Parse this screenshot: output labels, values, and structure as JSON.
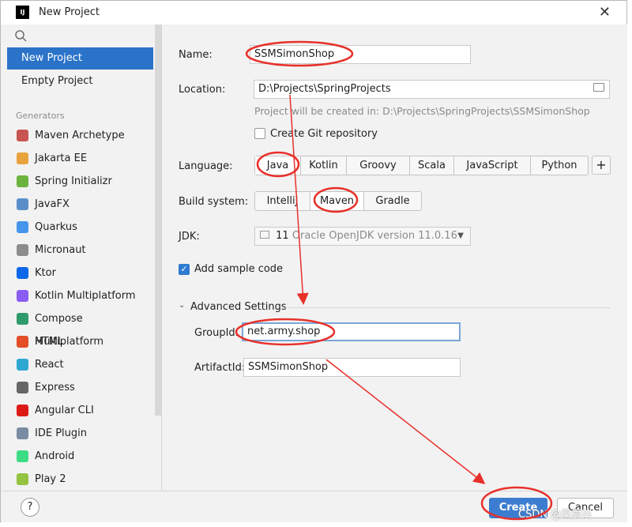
{
  "window": {
    "title": "New Project",
    "logo_text": "IJ"
  },
  "sidebar": {
    "top_items": [
      {
        "label": "New Project",
        "selected": true
      },
      {
        "label": "Empty Project",
        "selected": false
      }
    ],
    "generators_header": "Generators",
    "generators": [
      {
        "label": "Maven Archetype",
        "icon": "maven-icon",
        "color": "#c75450"
      },
      {
        "label": "Jakarta EE",
        "icon": "jakarta-icon",
        "color": "#e8a33d"
      },
      {
        "label": "Spring Initializr",
        "icon": "spring-icon",
        "color": "#6db33f"
      },
      {
        "label": "JavaFX",
        "icon": "javafx-icon",
        "color": "#5a8ec9"
      },
      {
        "label": "Quarkus",
        "icon": "quarkus-icon",
        "color": "#4695eb"
      },
      {
        "label": "Micronaut",
        "icon": "micronaut-icon",
        "color": "#8c8c8c"
      },
      {
        "label": "Ktor",
        "icon": "ktor-icon",
        "color": "#0d67e8"
      },
      {
        "label": "Kotlin Multiplatform",
        "icon": "kotlin-icon",
        "color": "#8a5cf5"
      },
      {
        "label": "Compose Multiplatform",
        "icon": "compose-icon",
        "color": "#2f9a6c"
      },
      {
        "label": "HTML",
        "icon": "html5-icon",
        "color": "#e44d26"
      },
      {
        "label": "React",
        "icon": "react-icon",
        "color": "#2ea8d3"
      },
      {
        "label": "Express",
        "icon": "express-icon",
        "color": "#666666"
      },
      {
        "label": "Angular CLI",
        "icon": "angular-icon",
        "color": "#dd1b16"
      },
      {
        "label": "IDE Plugin",
        "icon": "plugin-icon",
        "color": "#7a8ca3"
      },
      {
        "label": "Android",
        "icon": "android-icon",
        "color": "#3ddc84"
      },
      {
        "label": "Play 2",
        "icon": "play-icon",
        "color": "#93c33f"
      }
    ]
  },
  "form": {
    "name_label": "Name:",
    "name_value": "SSMSimonShop",
    "location_label": "Location:",
    "location_value": "D:\\Projects\\SpringProjects",
    "location_hint": "Project will be created in: D:\\Projects\\SpringProjects\\SSMSimonShop",
    "git_label": "Create Git repository",
    "language_label": "Language:",
    "languages": [
      "Java",
      "Kotlin",
      "Groovy",
      "Scala",
      "JavaScript",
      "Python"
    ],
    "language_selected": "Java",
    "build_label": "Build system:",
    "build_systems": [
      "IntelliJ",
      "Maven",
      "Gradle"
    ],
    "build_selected": "Maven",
    "jdk_label": "JDK:",
    "jdk_version": "11",
    "jdk_name": "Oracle OpenJDK version 11.0.16",
    "sample_label": "Add sample code",
    "advanced_label": "Advanced Settings",
    "groupid_label": "GroupId:",
    "groupid_value": "net.army.shop",
    "artifactid_label": "ArtifactId:",
    "artifactid_value": "SSMSimonShop"
  },
  "footer": {
    "help": "?",
    "create": "Create",
    "cancel": "Cancel"
  },
  "watermark": "CSDN @梁辰兴",
  "annotation_color": "#e8302a"
}
